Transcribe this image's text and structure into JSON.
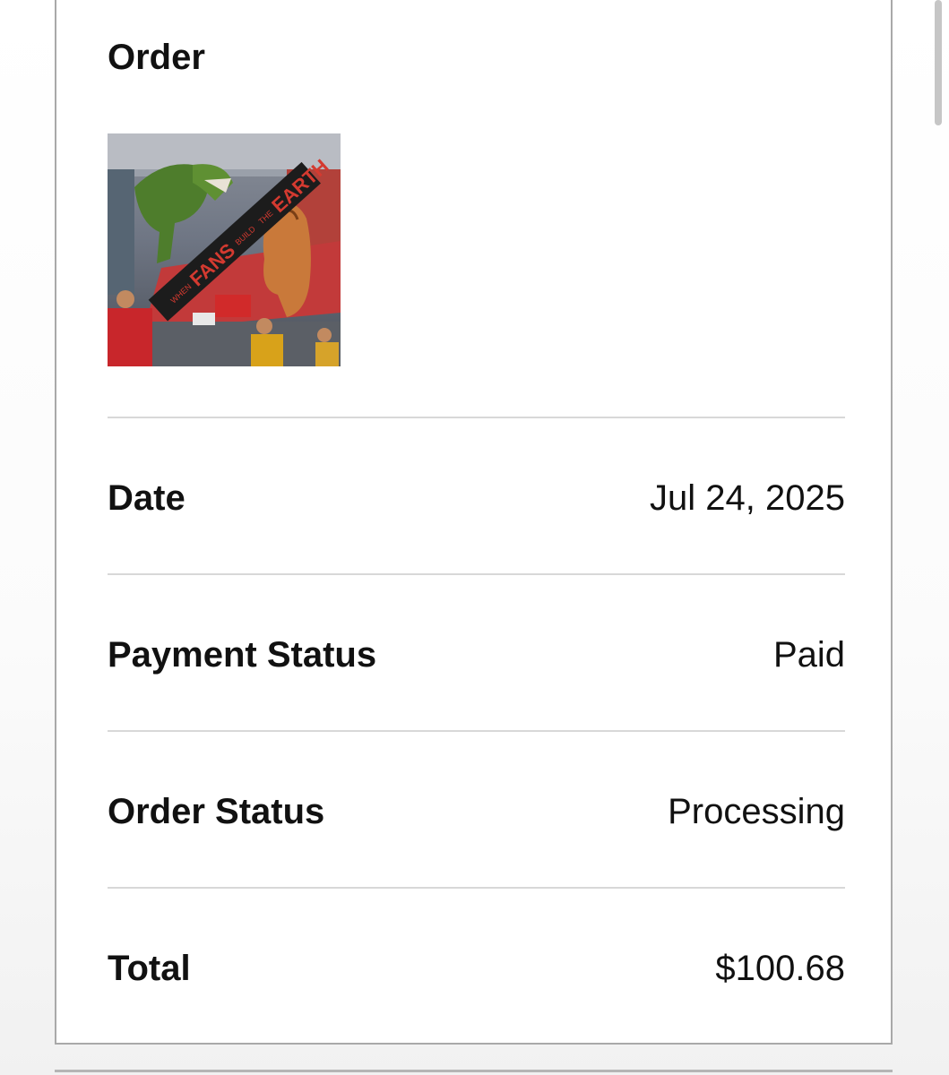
{
  "order": {
    "heading": "Order",
    "product_image": {
      "icon": "product-image",
      "banner_text": "WHEN FANS BUILD THE EARTH"
    },
    "rows": [
      {
        "label": "Date",
        "value": "Jul 24, 2025"
      },
      {
        "label": "Payment Status",
        "value": "Paid"
      },
      {
        "label": "Order Status",
        "value": "Processing"
      },
      {
        "label": "Total",
        "value": "$100.68"
      }
    ]
  },
  "colors": {
    "text": "#111111",
    "divider": "#d8d8d8",
    "card_border": "#a9a9a9",
    "banner_red": "#c8281e"
  }
}
